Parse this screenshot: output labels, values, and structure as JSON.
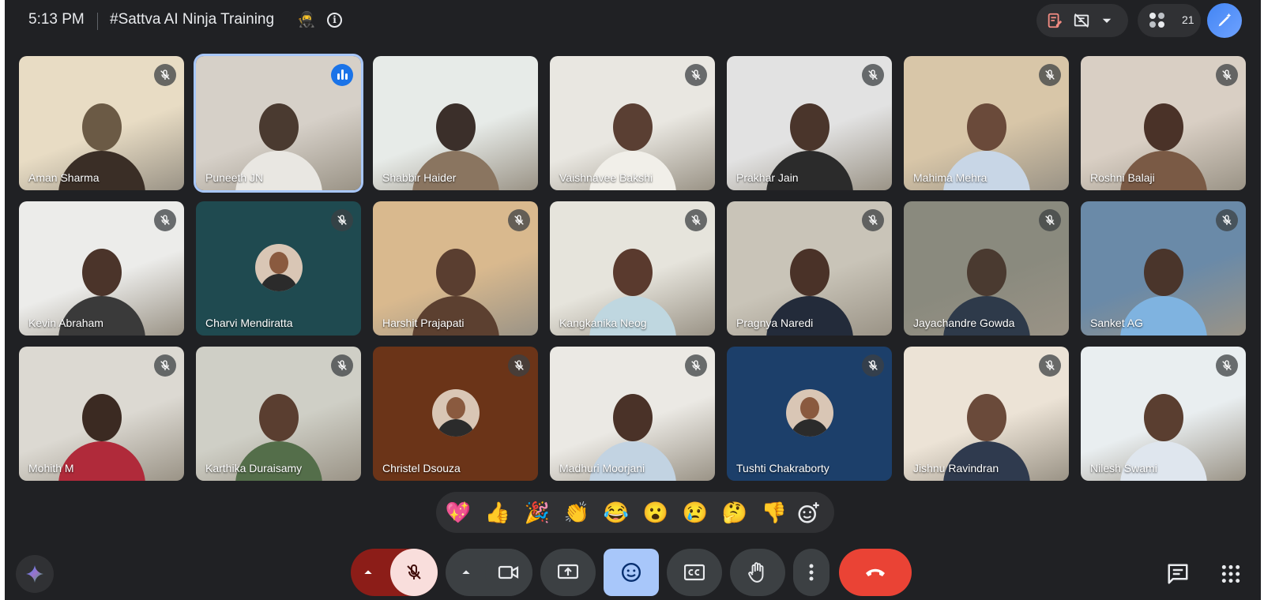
{
  "header": {
    "time": "5:13 PM",
    "meeting_title": "#Sattva AI Ninja Training",
    "title_emoji": "🥷",
    "info_icon": "info-icon",
    "participant_count": "21"
  },
  "participants": [
    {
      "name": "Aman Sharma",
      "muted": true
    },
    {
      "name": "Puneeth JN",
      "muted": false,
      "speaking": true
    },
    {
      "name": "Shabbir Haider",
      "muted": false
    },
    {
      "name": "Vaishnavee Bakshi",
      "muted": true
    },
    {
      "name": "Prakhar Jain",
      "muted": true
    },
    {
      "name": "Mahima Mehra",
      "muted": true
    },
    {
      "name": "Roshni Balaji",
      "muted": true
    },
    {
      "name": "Kevin Abraham",
      "muted": true
    },
    {
      "name": "Charvi Mendiratta",
      "muted": true,
      "camera_off": true
    },
    {
      "name": "Harshit Prajapati",
      "muted": true
    },
    {
      "name": "Kangkanika Neog",
      "muted": true
    },
    {
      "name": "Pragnya Naredi",
      "muted": true
    },
    {
      "name": "Jayachandre Gowda",
      "muted": true
    },
    {
      "name": "Sanket AG",
      "muted": true
    },
    {
      "name": "Mohith M",
      "muted": true
    },
    {
      "name": "Karthika Duraisamy",
      "muted": true
    },
    {
      "name": "Christel Dsouza",
      "muted": true,
      "camera_off": true
    },
    {
      "name": "Madhuri Moorjani",
      "muted": true
    },
    {
      "name": "Tushti Chakraborty",
      "muted": true,
      "camera_off": true
    },
    {
      "name": "Jishnu Ravindran",
      "muted": true
    },
    {
      "name": "Nilesh Swami",
      "muted": true
    }
  ],
  "reactions": [
    "💖",
    "👍",
    "🎉",
    "👏",
    "😂",
    "😮",
    "😢",
    "🤔",
    "👎"
  ],
  "controls": {
    "mic": "mic-off-icon",
    "camera": "camera-icon",
    "present": "present-screen-icon",
    "reactions": "emoji-icon",
    "captions": "captions-icon",
    "raise_hand": "raise-hand-icon",
    "more": "more-options-icon",
    "leave": "leave-call-icon",
    "chat": "chat-icon",
    "apps": "apps-grid-icon"
  },
  "colors": {
    "background": "#202124",
    "leave": "#ea4335",
    "reactions_active": "#a8c7fa",
    "mic_active_bg": "#f9dedc"
  }
}
